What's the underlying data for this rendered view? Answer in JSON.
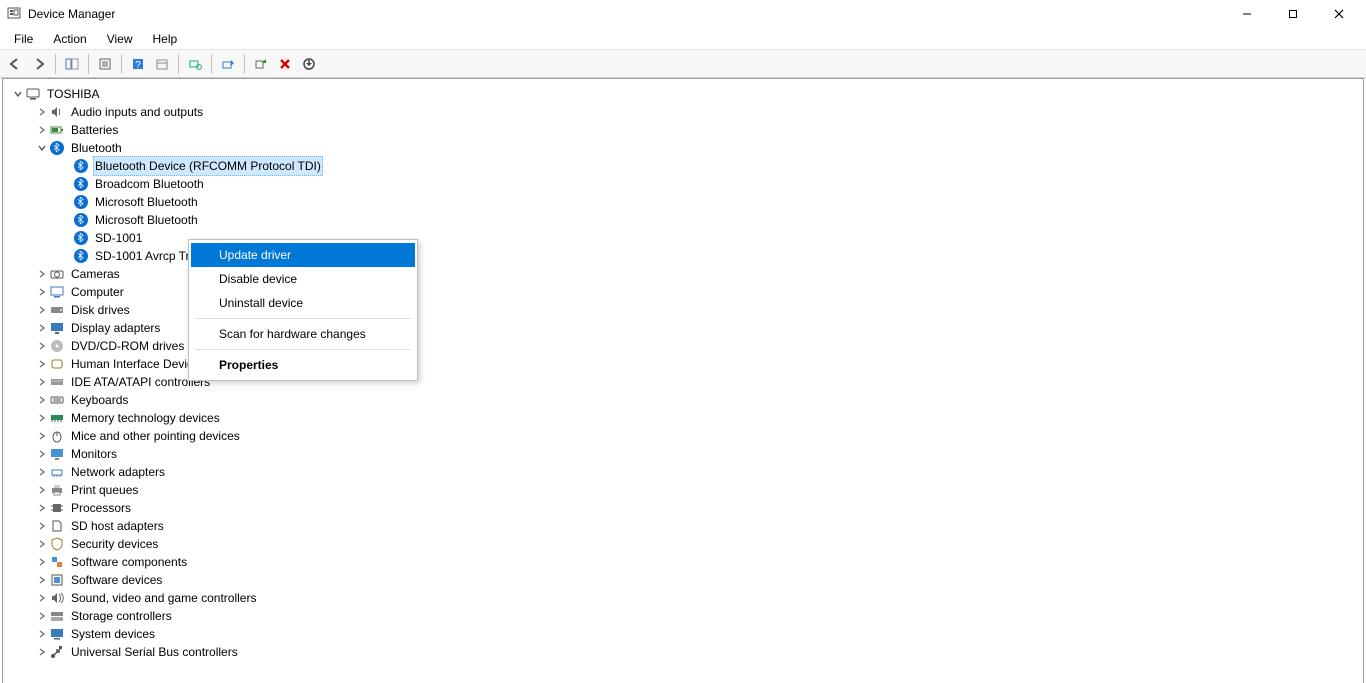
{
  "window": {
    "title": "Device Manager"
  },
  "menubar": {
    "file": "File",
    "action": "Action",
    "view": "View",
    "help": "Help"
  },
  "tree": {
    "root": "TOSHIBA",
    "audio": "Audio inputs and outputs",
    "batteries": "Batteries",
    "bluetooth": "Bluetooth",
    "bt_children": {
      "rfcomm": "Bluetooth Device (RFCOMM Protocol TDI)",
      "broadcom": "Broadcom Bluetooth",
      "ms1": "Microsoft Bluetooth",
      "ms2": "Microsoft Bluetooth",
      "sd1001": "SD-1001",
      "sd1001avrcp": "SD-1001 Avrcp Transport"
    },
    "cameras": "Cameras",
    "computer": "Computer",
    "disk": "Disk drives",
    "display": "Display adapters",
    "dvd": "DVD/CD-ROM drives",
    "hid": "Human Interface Devices",
    "ide": "IDE ATA/ATAPI controllers",
    "keyboards": "Keyboards",
    "memtech": "Memory technology devices",
    "mice": "Mice and other pointing devices",
    "monitors": "Monitors",
    "net": "Network adapters",
    "printq": "Print queues",
    "processors": "Processors",
    "sdhost": "SD host adapters",
    "security": "Security devices",
    "swcomp": "Software components",
    "swdev": "Software devices",
    "sound": "Sound, video and game controllers",
    "storage": "Storage controllers",
    "sysdev": "System devices",
    "usb": "Universal Serial Bus controllers"
  },
  "context_menu": {
    "update": "Update driver",
    "disable": "Disable device",
    "uninstall": "Uninstall device",
    "scan": "Scan for hardware changes",
    "properties": "Properties"
  }
}
